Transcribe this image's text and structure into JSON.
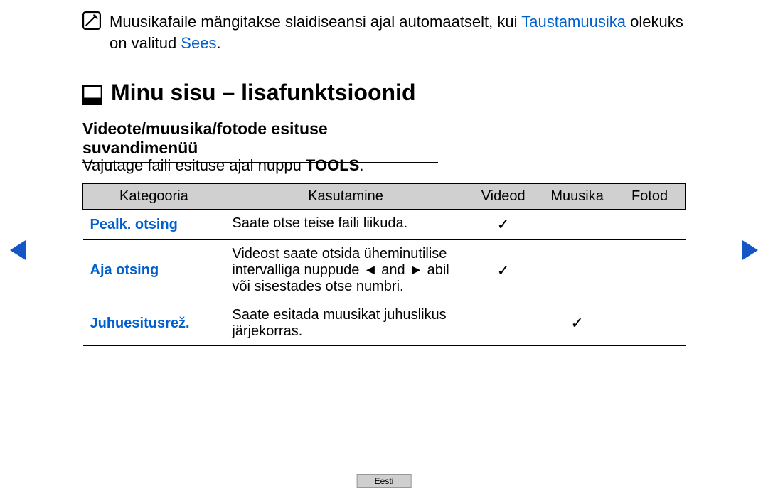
{
  "note": {
    "pre": "Muusikafaile mängitakse slaidiseansi ajal automaatselt, kui ",
    "link1": "Taustamuusika",
    "mid": " olekuks on valitud ",
    "link2": "Sees",
    "post": "."
  },
  "section": {
    "title": "Minu sisu – lisafunktsioonid",
    "subtitle": "Videote/muusika/fotode esituse suvandimenüü",
    "instr_pre": "Vajutage faili esituse ajal nuppu ",
    "instr_key": "TOOLS",
    "instr_post": "."
  },
  "table": {
    "headers": {
      "cat": "Kategooria",
      "use": "Kasutamine",
      "vid": "Videod",
      "mus": "Muusika",
      "pho": "Fotod"
    },
    "rows": [
      {
        "cat": "Pealk. otsing",
        "use": "Saate otse teise faili liikuda.",
        "vid": "✓",
        "mus": "",
        "pho": ""
      },
      {
        "cat": "Aja otsing",
        "use": "Videost saate otsida üheminutilise intervalliga nuppude ◄ and ► abil või sisestades otse numbri.",
        "vid": "✓",
        "mus": "",
        "pho": ""
      },
      {
        "cat": "Juhuesitusrež.",
        "use": "Saate esitada muusikat juhuslikus järjekorras.",
        "vid": "",
        "mus": "✓",
        "pho": ""
      }
    ]
  },
  "footer": {
    "lang": "Eesti"
  }
}
